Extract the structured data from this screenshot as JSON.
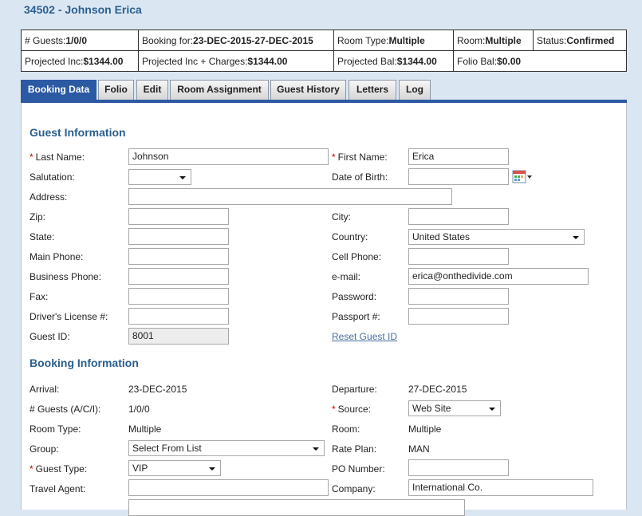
{
  "page": {
    "title": "34502 - Johnson Erica"
  },
  "summary": {
    "guests_label": "# Guests:",
    "guests_value": "1/0/0",
    "booking_for_label": "Booking for:",
    "booking_for_value": "23-DEC-2015-27-DEC-2015",
    "room_type_label": "Room Type:",
    "room_type_value": "Multiple",
    "room_label": "Room:",
    "room_value": "Multiple",
    "status_label": "Status:",
    "status_value": "Confirmed",
    "proj_inc_label": "Projected Inc:",
    "proj_inc_value": "$1344.00",
    "proj_inc_charges_label": "Projected Inc + Charges:",
    "proj_inc_charges_value": "$1344.00",
    "proj_bal_label": "Projected Bal:",
    "proj_bal_value": "$1344.00",
    "folio_bal_label": "Folio Bal:",
    "folio_bal_value": "$0.00"
  },
  "tabs": [
    "Booking Data",
    "Folio",
    "Edit",
    "Room Assignment",
    "Guest History",
    "Letters",
    "Log"
  ],
  "guest": {
    "section_title": "Guest Information",
    "last_name_label": "Last Name:",
    "last_name": "Johnson",
    "first_name_label": "First Name:",
    "first_name": "Erica",
    "salutation_label": "Salutation:",
    "salutation": "",
    "dob_label": "Date of Birth:",
    "dob": "",
    "address_label": "Address:",
    "address": "",
    "zip_label": "Zip:",
    "zip": "",
    "city_label": "City:",
    "city": "",
    "state_label": "State:",
    "state": "",
    "country_label": "Country:",
    "country": "United States",
    "main_phone_label": "Main Phone:",
    "main_phone": "",
    "cell_phone_label": "Cell Phone:",
    "cell_phone": "",
    "business_phone_label": "Business Phone:",
    "business_phone": "",
    "email_label": "e-mail:",
    "email": "erica@onthedivide.com",
    "fax_label": "Fax:",
    "fax": "",
    "password_label": "Password:",
    "password": "",
    "license_label": "Driver's License #:",
    "license": "",
    "passport_label": "Passport #:",
    "passport": "",
    "guest_id_label": "Guest ID:",
    "guest_id": "8001",
    "reset_link": "Reset Guest ID"
  },
  "booking": {
    "section_title": "Booking Information",
    "arrival_label": "Arrival:",
    "arrival": "23-DEC-2015",
    "departure_label": "Departure:",
    "departure": "27-DEC-2015",
    "guests_label": "# Guests (A/C/I):",
    "guests": "1/0/0",
    "source_label": "Source:",
    "source": "Web Site",
    "room_type_label": "Room Type:",
    "room_type": "Multiple",
    "room_label": "Room:",
    "room": "Multiple",
    "group_label": "Group:",
    "group": "Select From List",
    "rate_plan_label": "Rate Plan:",
    "rate_plan": "MAN",
    "guest_type_label": "Guest Type:",
    "guest_type": "VIP",
    "po_number_label": "PO Number:",
    "po_number": "",
    "travel_agent_label": "Travel Agent:",
    "travel_agent": "",
    "company_label": "Company:",
    "company": "International Co.",
    "required_mark": "*"
  }
}
